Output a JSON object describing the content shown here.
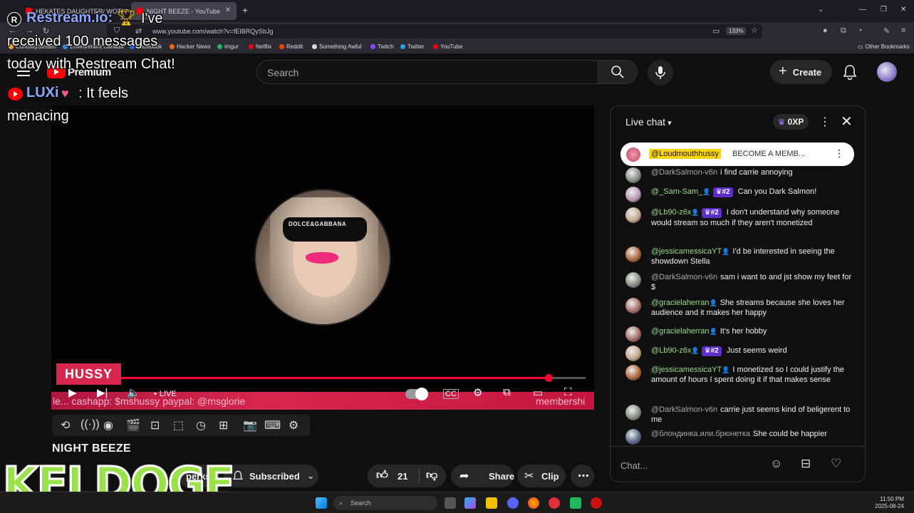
{
  "browser": {
    "tabs": [
      {
        "label": "HEKATES DAUGHTER/ WOTI &"
      },
      {
        "label": "NIGHT BEEZE - YouTube"
      }
    ],
    "url": "www.youtube.com/watch?v=fEIBRQySbJg",
    "zoom": "133%",
    "other_bookmarks": "Other Bookmarks",
    "bookmarks": [
      {
        "label": "CuriosityStream",
        "color": "#e9a53a"
      },
      {
        "label": "Environment Canada",
        "color": "#3a8fe9"
      },
      {
        "label": "Facebook",
        "color": "#1877f2"
      },
      {
        "label": "Hacker News",
        "color": "#ff6600"
      },
      {
        "label": "imgur",
        "color": "#1bb76e"
      },
      {
        "label": "Netflix",
        "color": "#e50914"
      },
      {
        "label": "Reddit",
        "color": "#ff4500"
      },
      {
        "label": "Something Awful",
        "color": "#d9d9d9"
      },
      {
        "label": "Twitch",
        "color": "#9146ff"
      },
      {
        "label": "Twitter",
        "color": "#1da1f2"
      },
      {
        "label": "YouTube",
        "color": "#ff0000"
      }
    ]
  },
  "overlay": {
    "brand": "Restream.io:",
    "line1": "I've",
    "line2": "received 100 messages",
    "line3": "today with Restream Chat!",
    "user": "LUXi",
    "msg1": ": It feels",
    "msg2": "menacing"
  },
  "header": {
    "premium": "Premium",
    "search_placeholder": "Search",
    "create": "Create"
  },
  "player": {
    "banner": "HUSSY",
    "live": "LIVE",
    "ticker": "le... cashapp: $mshussy paypal: @msglorie",
    "ticker_right": "membershi",
    "progress": 0.92,
    "buffered": 0.96
  },
  "video": {
    "title": "NIGHT BEEZE",
    "perks": "perks",
    "subscribed": "Subscribed",
    "likes": "21",
    "share": "Share",
    "clip": "Clip"
  },
  "watermark": "KELDOGE",
  "chat": {
    "title": "Live chat",
    "xp": "0XP",
    "pinned_user": "@Loudmouthhussy",
    "pinned_msg": "BECOME A MEMB...",
    "input_placeholder": "Chat...",
    "messages": [
      {
        "user": "@DarkSalmon-v6n",
        "grey": true,
        "badge": false,
        "rank": "",
        "text": "i find carrie annoying",
        "av": "#8a8f84"
      },
      {
        "user": "@_Sam-Sam_",
        "grey": false,
        "badge": true,
        "rank": "#2",
        "text": "Can you Dark Salmon!",
        "av": "#b798b0"
      },
      {
        "user": "@Lb90-z6x",
        "grey": false,
        "badge": true,
        "rank": "#2",
        "text": "I don't understand why someone would stream so much if they aren't monetized",
        "av": "#c4a88d"
      },
      {
        "user": "@jessicamessicaYT",
        "grey": false,
        "badge": true,
        "rank": "",
        "text": "I'd be interested in seeing the showdown Stella",
        "av": "#b06a40"
      },
      {
        "user": "@DarkSalmon-v6n",
        "grey": true,
        "badge": false,
        "rank": "",
        "text": "sam i want to and jst show my feet for $",
        "av": "#8a8f84"
      },
      {
        "user": "@gracielaherran",
        "grey": false,
        "badge": true,
        "rank": "",
        "text": "She streams because she loves her audience and it makes her happy",
        "av": "#a8706a"
      },
      {
        "user": "@gracielaherran",
        "grey": false,
        "badge": true,
        "rank": "",
        "text": "It's her hobby",
        "av": "#a8706a"
      },
      {
        "user": "@Lb90-z6x",
        "grey": false,
        "badge": true,
        "rank": "#2",
        "text": "Just seems weird",
        "av": "#c4a88d"
      },
      {
        "user": "@jessicamessicaYT",
        "grey": false,
        "badge": true,
        "rank": "",
        "text": "I monetized so I could justify the amount of hours I spent doing it if that makes sense",
        "av": "#b06a40"
      },
      {
        "user": "@DarkSalmon-v6n",
        "grey": true,
        "badge": false,
        "rank": "",
        "text": "carrie just seems kind of beligerent to me",
        "av": "#8a8f84"
      },
      {
        "user": "@блондинка.или.брюнетка",
        "grey": true,
        "badge": false,
        "rank": "",
        "text": "She could be happier",
        "av": "#5c6b8a"
      }
    ]
  },
  "taskbar": {
    "search": "Search",
    "time": "11:50 PM",
    "date": "2025-08-24"
  }
}
